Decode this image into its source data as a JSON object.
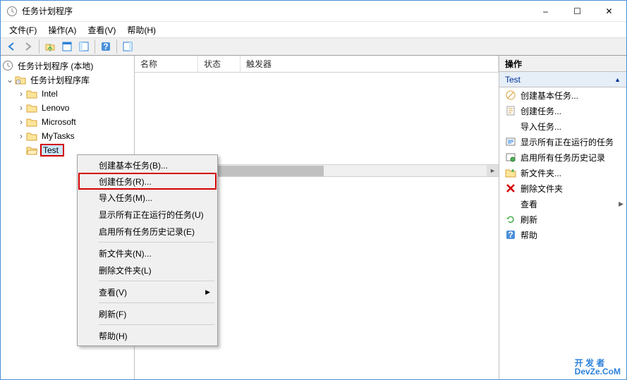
{
  "window": {
    "title": "任务计划程序",
    "min": "–",
    "max": "☐",
    "close": "✕"
  },
  "menubar": [
    "文件(F)",
    "操作(A)",
    "查看(V)",
    "帮助(H)"
  ],
  "tree": {
    "root": "任务计划程序 (本地)",
    "lib": "任务计划程序库",
    "items": [
      "Intel",
      "Lenovo",
      "Microsoft",
      "MyTasks",
      "Test"
    ],
    "selected": "Test"
  },
  "listCols": [
    "名称",
    "状态",
    "触发器"
  ],
  "contextMenu": [
    {
      "label": "创建基本任务(B)...",
      "type": "item"
    },
    {
      "label": "创建任务(R)...",
      "type": "item",
      "hl": true
    },
    {
      "label": "导入任务(M)...",
      "type": "item"
    },
    {
      "label": "显示所有正在运行的任务(U)",
      "type": "item"
    },
    {
      "label": "启用所有任务历史记录(E)",
      "type": "item"
    },
    {
      "type": "sep"
    },
    {
      "label": "新文件夹(N)...",
      "type": "item"
    },
    {
      "label": "删除文件夹(L)",
      "type": "item"
    },
    {
      "type": "sep"
    },
    {
      "label": "查看(V)",
      "type": "item",
      "sub": true
    },
    {
      "type": "sep"
    },
    {
      "label": "刷新(F)",
      "type": "item"
    },
    {
      "type": "sep"
    },
    {
      "label": "帮助(H)",
      "type": "item"
    }
  ],
  "actions": {
    "header": "操作",
    "subheader": "Test",
    "items": [
      {
        "icon": "wizard",
        "label": "创建基本任务..."
      },
      {
        "icon": "task",
        "label": "创建任务..."
      },
      {
        "icon": "blank",
        "label": "导入任务..."
      },
      {
        "icon": "running",
        "label": "显示所有正在运行的任务"
      },
      {
        "icon": "history",
        "label": "启用所有任务历史记录"
      },
      {
        "icon": "newfolder",
        "label": "新文件夹..."
      },
      {
        "icon": "delete",
        "label": "删除文件夹"
      },
      {
        "icon": "blank",
        "label": "查看",
        "sub": true
      },
      {
        "icon": "refresh",
        "label": "刷新"
      },
      {
        "icon": "help",
        "label": "帮助"
      }
    ]
  },
  "watermark": {
    "l1": "开 发 者",
    "l2": "DevZe.CoM"
  }
}
